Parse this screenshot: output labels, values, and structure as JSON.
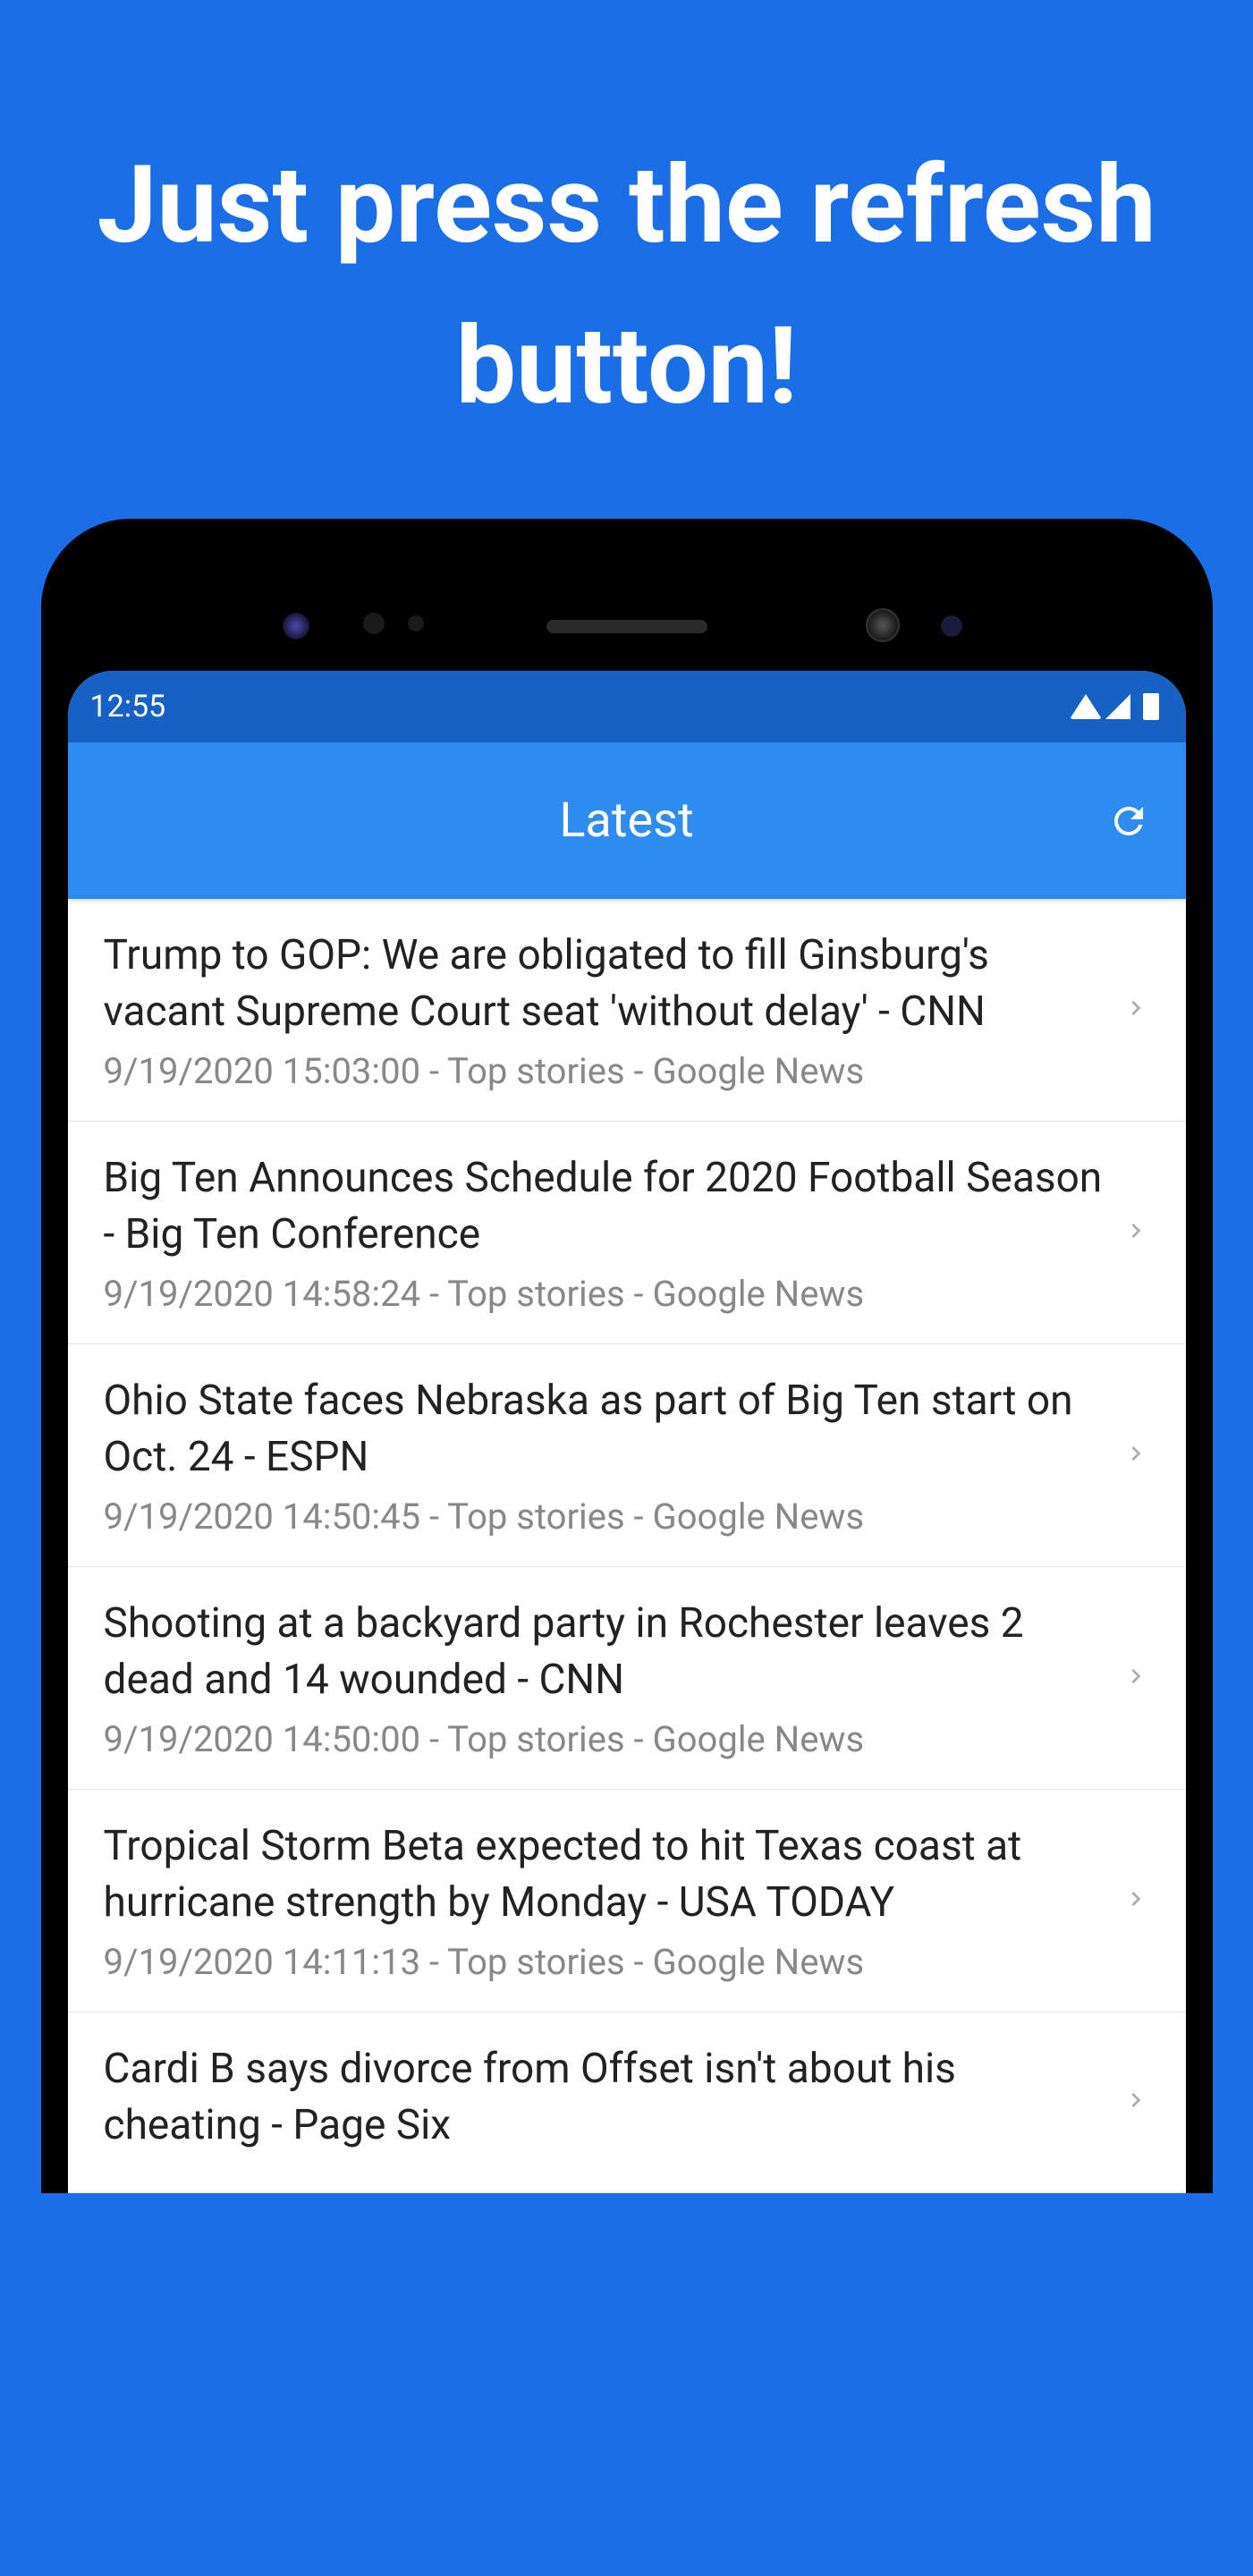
{
  "promo": {
    "text": "Just press the refresh button!"
  },
  "status_bar": {
    "time": "12:55"
  },
  "app_bar": {
    "title": "Latest"
  },
  "news": [
    {
      "headline": "Trump to GOP: We are obligated to fill Ginsburg's vacant Supreme Court seat 'without delay' - CNN",
      "meta": "9/19/2020 15:03:00 - Top stories - Google News"
    },
    {
      "headline": "Big Ten Announces Schedule for 2020 Football Season - Big Ten Conference",
      "meta": "9/19/2020 14:58:24 - Top stories - Google News"
    },
    {
      "headline": "Ohio State faces Nebraska as part of Big Ten start on Oct. 24 - ESPN",
      "meta": "9/19/2020 14:50:45 - Top stories - Google News"
    },
    {
      "headline": "Shooting at a backyard party in Rochester leaves 2 dead and 14 wounded - CNN",
      "meta": "9/19/2020 14:50:00 - Top stories - Google News"
    },
    {
      "headline": "Tropical Storm Beta expected to hit Texas coast at hurricane strength by Monday - USA TODAY",
      "meta": "9/19/2020 14:11:13 - Top stories - Google News"
    },
    {
      "headline": "Cardi B says divorce from Offset isn't about his cheating - Page Six",
      "meta": ""
    }
  ]
}
